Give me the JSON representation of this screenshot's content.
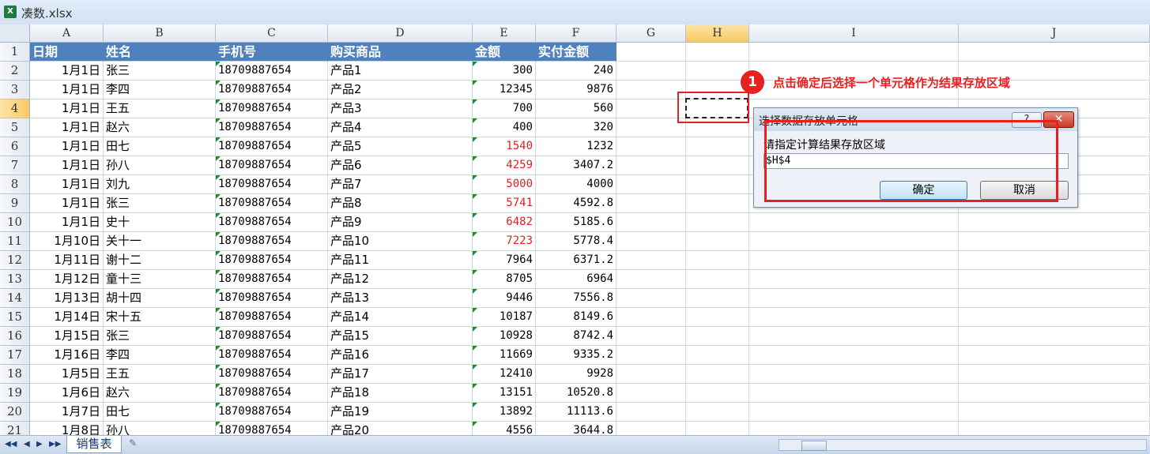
{
  "window": {
    "title": "凑数.xlsx",
    "app_icon": "excel-icon"
  },
  "columns": [
    "A",
    "B",
    "C",
    "D",
    "E",
    "F",
    "G",
    "H",
    "I",
    "J"
  ],
  "header_row": [
    "日期",
    "姓名",
    "手机号",
    "购买商品",
    "金额",
    "实付金额"
  ],
  "rows": [
    [
      "1月1日",
      "张三",
      "18709887654",
      "产品1",
      "300",
      "240"
    ],
    [
      "1月1日",
      "李四",
      "18709887654",
      "产品2",
      "12345",
      "9876"
    ],
    [
      "1月1日",
      "王五",
      "18709887654",
      "产品3",
      "700",
      "560"
    ],
    [
      "1月1日",
      "赵六",
      "18709887654",
      "产品4",
      "400",
      "320"
    ],
    [
      "1月1日",
      "田七",
      "18709887654",
      "产品5",
      "1540",
      "1232"
    ],
    [
      "1月1日",
      "孙八",
      "18709887654",
      "产品6",
      "4259",
      "3407.2"
    ],
    [
      "1月1日",
      "刘九",
      "18709887654",
      "产品7",
      "5000",
      "4000"
    ],
    [
      "1月1日",
      "张三",
      "18709887654",
      "产品8",
      "5741",
      "4592.8"
    ],
    [
      "1月1日",
      "史十",
      "18709887654",
      "产品9",
      "6482",
      "5185.6"
    ],
    [
      "1月10日",
      "关十一",
      "18709887654",
      "产品10",
      "7223",
      "5778.4"
    ],
    [
      "1月11日",
      "谢十二",
      "18709887654",
      "产品11",
      "7964",
      "6371.2"
    ],
    [
      "1月12日",
      "童十三",
      "18709887654",
      "产品12",
      "8705",
      "6964"
    ],
    [
      "1月13日",
      "胡十四",
      "18709887654",
      "产品13",
      "9446",
      "7556.8"
    ],
    [
      "1月14日",
      "宋十五",
      "18709887654",
      "产品14",
      "10187",
      "8149.6"
    ],
    [
      "1月15日",
      "张三",
      "18709887654",
      "产品15",
      "10928",
      "8742.4"
    ],
    [
      "1月16日",
      "李四",
      "18709887654",
      "产品16",
      "11669",
      "9335.2"
    ],
    [
      "1月5日",
      "王五",
      "18709887654",
      "产品17",
      "12410",
      "9928"
    ],
    [
      "1月6日",
      "赵六",
      "18709887654",
      "产品18",
      "13151",
      "10520.8"
    ],
    [
      "1月7日",
      "田七",
      "18709887654",
      "产品19",
      "13892",
      "11113.6"
    ],
    [
      "1月8日",
      "孙八",
      "18709887654",
      "产品20",
      "4556",
      "3644.8"
    ]
  ],
  "red_amount_rows": [
    4,
    5,
    6,
    7,
    8,
    9
  ],
  "selected_column": "H",
  "selected_row": 4,
  "annotation": {
    "number": "1",
    "text": "点击确定后选择一个单元格作为结果存放区域"
  },
  "dialog": {
    "title": "选择数据存放单元格",
    "help_label": "?",
    "close_label": "✕",
    "prompt": "请指定计算结果存放区域",
    "value": "$H$4",
    "ok_label": "确定",
    "cancel_label": "取消"
  },
  "sheet_tabs": [
    "销售表"
  ],
  "colors": {
    "header_bg": "#4f81bd",
    "annotation": "#e82020",
    "selected_header": "#f8c964"
  }
}
